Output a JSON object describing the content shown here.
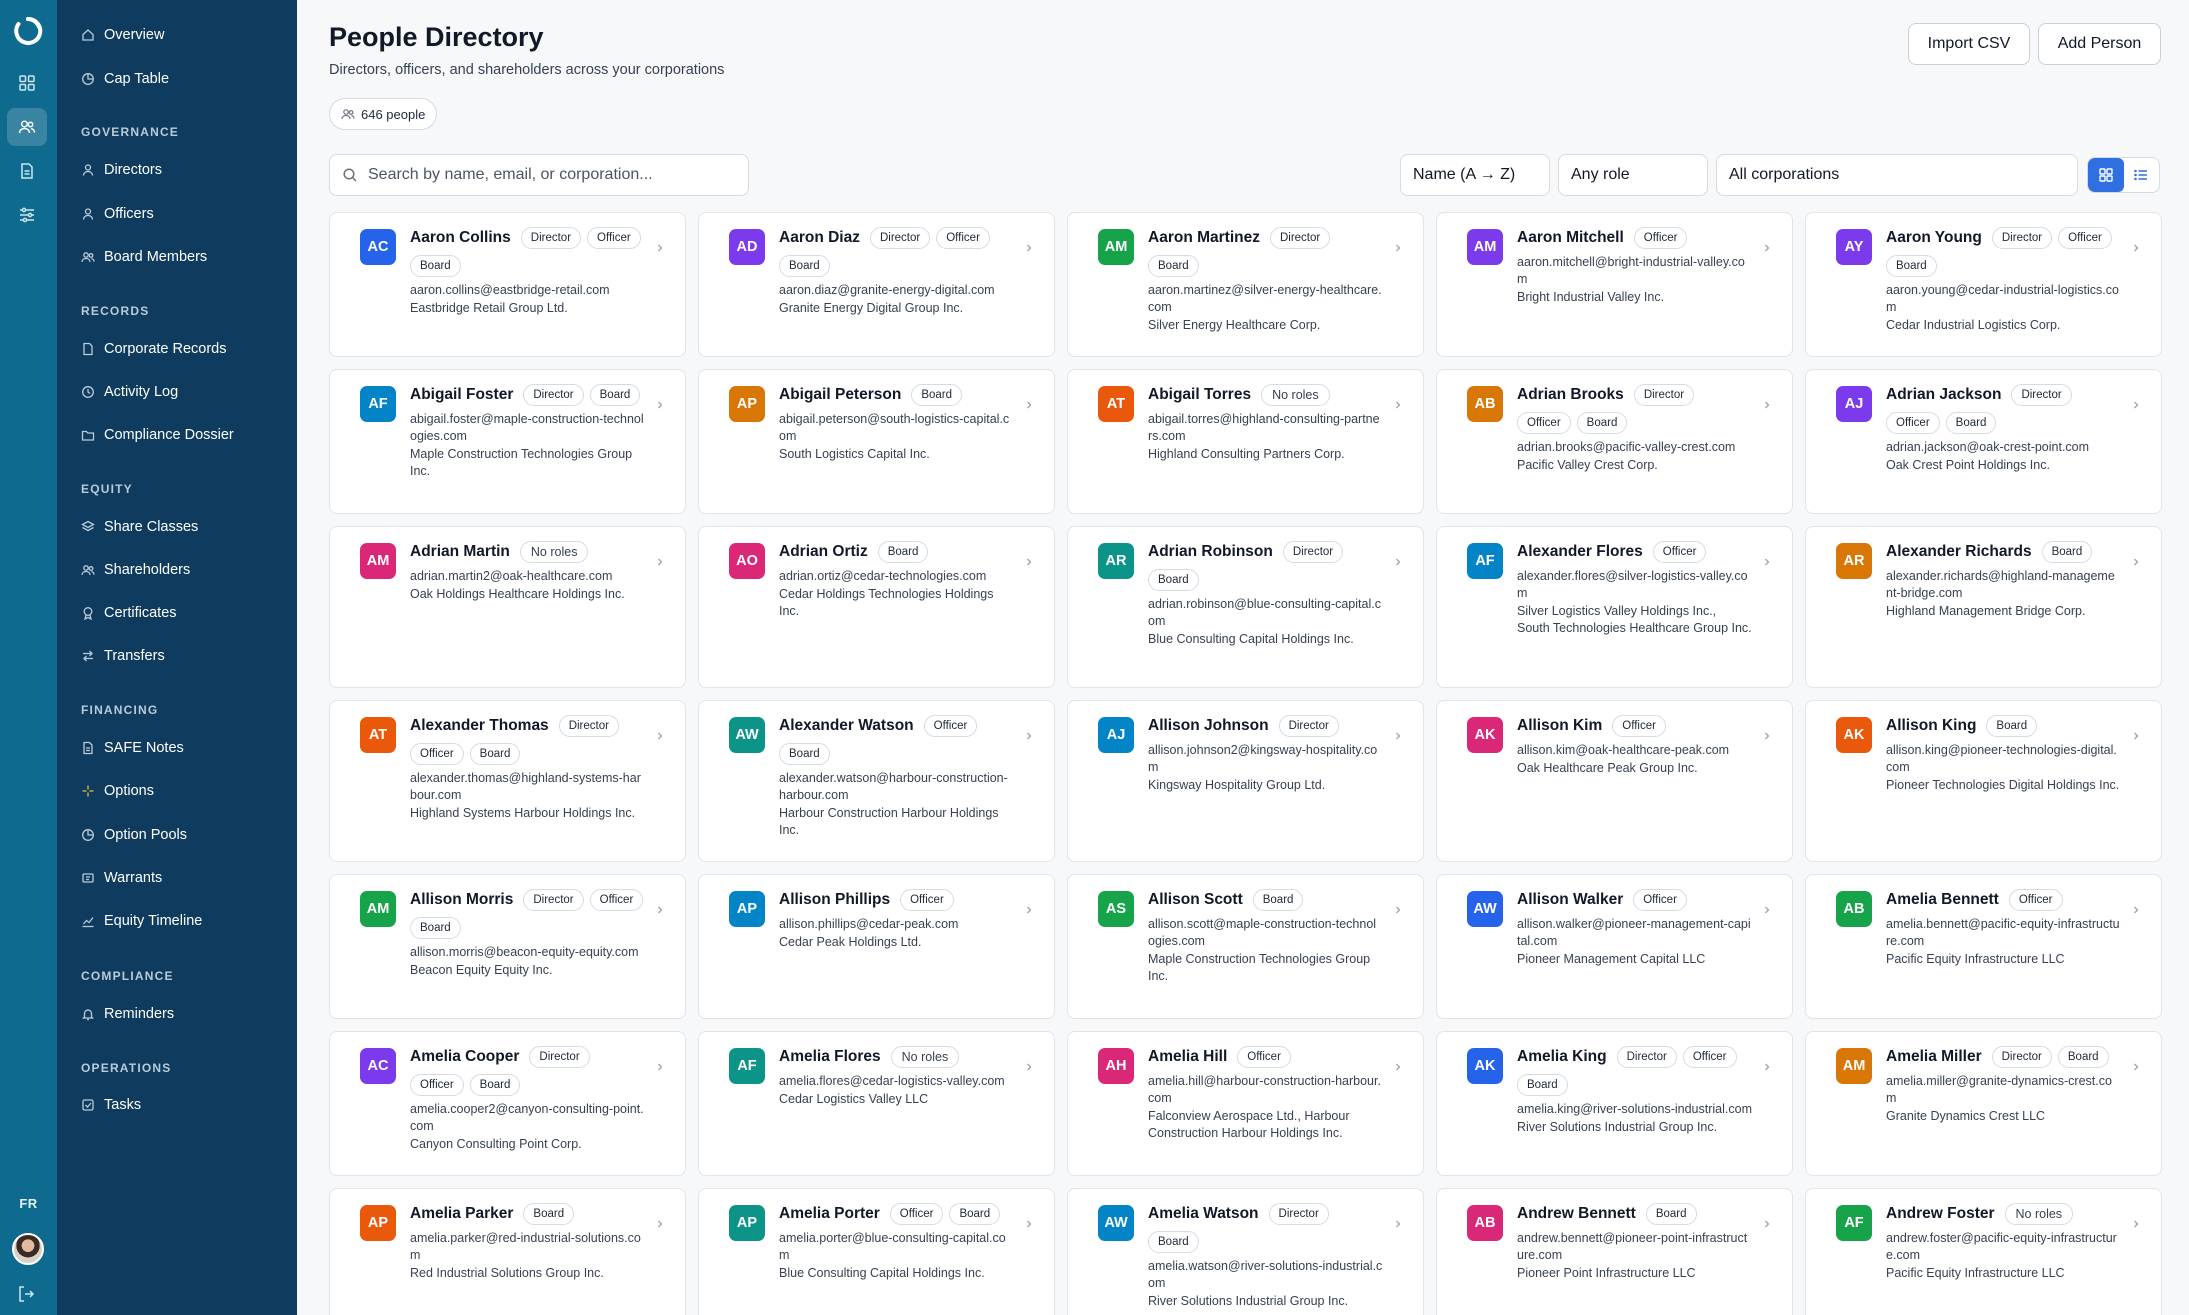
{
  "sidebar": {
    "items": [
      {
        "label": "Overview",
        "icon": "home-icon"
      },
      {
        "label": "Cap Table",
        "icon": "pie-chart-icon"
      }
    ],
    "sections": [
      {
        "title": "GOVERNANCE",
        "items": [
          {
            "label": "Directors",
            "icon": "user-icon"
          },
          {
            "label": "Officers",
            "icon": "user-icon"
          },
          {
            "label": "Board Members",
            "icon": "users-icon"
          }
        ]
      },
      {
        "title": "RECORDS",
        "items": [
          {
            "label": "Corporate Records",
            "icon": "document-icon"
          },
          {
            "label": "Activity Log",
            "icon": "clock-icon"
          },
          {
            "label": "Compliance Dossier",
            "icon": "folder-icon"
          }
        ]
      },
      {
        "title": "EQUITY",
        "items": [
          {
            "label": "Share Classes",
            "icon": "layers-icon"
          },
          {
            "label": "Shareholders",
            "icon": "users-icon"
          },
          {
            "label": "Certificates",
            "icon": "award-icon"
          },
          {
            "label": "Transfers",
            "icon": "transfer-icon"
          }
        ]
      },
      {
        "title": "FINANCING",
        "items": [
          {
            "label": "SAFE Notes",
            "icon": "document-icon"
          },
          {
            "label": "Options",
            "icon": "sparkle-icon"
          },
          {
            "label": "Option Pools",
            "icon": "pie-chart-icon"
          },
          {
            "label": "Warrants",
            "icon": "ticket-icon"
          },
          {
            "label": "Equity Timeline",
            "icon": "chart-icon"
          }
        ]
      },
      {
        "title": "COMPLIANCE",
        "items": [
          {
            "label": "Reminders",
            "icon": "bell-icon"
          }
        ]
      },
      {
        "title": "OPERATIONS",
        "items": [
          {
            "label": "Tasks",
            "icon": "checkbox-icon"
          }
        ]
      }
    ]
  },
  "rail": {
    "language": "FR"
  },
  "header": {
    "title": "People Directory",
    "subtitle": "Directors, officers, and shareholders across your corporations",
    "count_label": "646 people",
    "import_label": "Import CSV",
    "add_label": "Add Person"
  },
  "filters": {
    "search_placeholder": "Search by name, email, or corporation...",
    "sort_value": "Name (A → Z)",
    "role_value": "Any role",
    "corporation_value": "All corporations"
  },
  "colors": {
    "rail": "#0e6a8e",
    "sidebar": "#0f3c5e",
    "accent": "#2f6fe0"
  },
  "people": [
    {
      "initials": "AC",
      "name": "Aaron Collins",
      "roles": [
        "Director",
        "Officer",
        "Board"
      ],
      "email": "aaron.collins@eastbridge-retail.com",
      "corporation": "Eastbridge Retail Group Ltd.",
      "color": "#2563eb"
    },
    {
      "initials": "AD",
      "name": "Aaron Diaz",
      "roles": [
        "Director",
        "Officer",
        "Board"
      ],
      "email": "aaron.diaz@granite-energy-digital.com",
      "corporation": "Granite Energy Digital Group Inc.",
      "color": "#7c3aed"
    },
    {
      "initials": "AM",
      "name": "Aaron Martinez",
      "roles": [
        "Director",
        "Board"
      ],
      "email": "aaron.martinez@silver-energy-healthcare.com",
      "corporation": "Silver Energy Healthcare Corp.",
      "color": "#16a34a"
    },
    {
      "initials": "AM",
      "name": "Aaron Mitchell",
      "roles": [
        "Officer"
      ],
      "email": "aaron.mitchell@bright-industrial-valley.com",
      "corporation": "Bright Industrial Valley Inc.",
      "color": "#7c3aed"
    },
    {
      "initials": "AY",
      "name": "Aaron Young",
      "roles": [
        "Director",
        "Officer",
        "Board"
      ],
      "email": "aaron.young@cedar-industrial-logistics.com",
      "corporation": "Cedar Industrial Logistics Corp.",
      "color": "#7c3aed"
    },
    {
      "initials": "AF",
      "name": "Abigail Foster",
      "roles": [
        "Director",
        "Board"
      ],
      "email": "abigail.foster@maple-construction-technologies.com",
      "corporation": "Maple Construction Technologies Group Inc.",
      "color": "#0284c7"
    },
    {
      "initials": "AP",
      "name": "Abigail Peterson",
      "roles": [
        "Board"
      ],
      "email": "abigail.peterson@south-logistics-capital.com",
      "corporation": "South Logistics Capital Inc.",
      "color": "#d97706"
    },
    {
      "initials": "AT",
      "name": "Abigail Torres",
      "roles": [],
      "email": "abigail.torres@highland-consulting-partners.com",
      "corporation": "Highland Consulting Partners Corp.",
      "color": "#ea580c"
    },
    {
      "initials": "AB",
      "name": "Adrian Brooks",
      "roles": [
        "Director",
        "Officer",
        "Board"
      ],
      "email": "adrian.brooks@pacific-valley-crest.com",
      "corporation": "Pacific Valley Crest Corp.",
      "color": "#d97706"
    },
    {
      "initials": "AJ",
      "name": "Adrian Jackson",
      "roles": [
        "Director",
        "Officer",
        "Board"
      ],
      "email": "adrian.jackson@oak-crest-point.com",
      "corporation": "Oak Crest Point Holdings Inc.",
      "color": "#7c3aed"
    },
    {
      "initials": "AM",
      "name": "Adrian Martin",
      "roles": [],
      "email": "adrian.martin2@oak-healthcare.com",
      "corporation": "Oak Holdings Healthcare Holdings Inc.",
      "color": "#db2777"
    },
    {
      "initials": "AO",
      "name": "Adrian Ortiz",
      "roles": [
        "Board"
      ],
      "email": "adrian.ortiz@cedar-technologies.com",
      "corporation": "Cedar Holdings Technologies Holdings Inc.",
      "color": "#db2777"
    },
    {
      "initials": "AR",
      "name": "Adrian Robinson",
      "roles": [
        "Director",
        "Board"
      ],
      "email": "adrian.robinson@blue-consulting-capital.com",
      "corporation": "Blue Consulting Capital Holdings Inc.",
      "color": "#0d9488"
    },
    {
      "initials": "AF",
      "name": "Alexander Flores",
      "roles": [
        "Officer"
      ],
      "email": "alexander.flores@silver-logistics-valley.com",
      "corporation": "Silver Logistics Valley Holdings Inc., South Technologies Healthcare Group Inc.",
      "color": "#0284c7"
    },
    {
      "initials": "AR",
      "name": "Alexander Richards",
      "roles": [
        "Board"
      ],
      "email": "alexander.richards@highland-management-bridge.com",
      "corporation": "Highland Management Bridge Corp.",
      "color": "#d97706"
    },
    {
      "initials": "AT",
      "name": "Alexander Thomas",
      "roles": [
        "Director",
        "Officer",
        "Board"
      ],
      "email": "alexander.thomas@highland-systems-harbour.com",
      "corporation": "Highland Systems Harbour Holdings Inc.",
      "color": "#ea580c"
    },
    {
      "initials": "AW",
      "name": "Alexander Watson",
      "roles": [
        "Officer",
        "Board"
      ],
      "email": "alexander.watson@harbour-construction-harbour.com",
      "corporation": "Harbour Construction Harbour Holdings Inc.",
      "color": "#0d9488"
    },
    {
      "initials": "AJ",
      "name": "Allison Johnson",
      "roles": [
        "Director"
      ],
      "email": "allison.johnson2@kingsway-hospitality.com",
      "corporation": "Kingsway Hospitality Group Ltd.",
      "color": "#0284c7"
    },
    {
      "initials": "AK",
      "name": "Allison Kim",
      "roles": [
        "Officer"
      ],
      "email": "allison.kim@oak-healthcare-peak.com",
      "corporation": "Oak Healthcare Peak Group Inc.",
      "color": "#db2777"
    },
    {
      "initials": "AK",
      "name": "Allison King",
      "roles": [
        "Board"
      ],
      "email": "allison.king@pioneer-technologies-digital.com",
      "corporation": "Pioneer Technologies Digital Holdings Inc.",
      "color": "#ea580c"
    },
    {
      "initials": "AM",
      "name": "Allison Morris",
      "roles": [
        "Director",
        "Officer",
        "Board"
      ],
      "email": "allison.morris@beacon-equity-equity.com",
      "corporation": "Beacon Equity Equity Inc.",
      "color": "#16a34a"
    },
    {
      "initials": "AP",
      "name": "Allison Phillips",
      "roles": [
        "Officer"
      ],
      "email": "allison.phillips@cedar-peak.com",
      "corporation": "Cedar Peak Holdings Ltd.",
      "color": "#0284c7"
    },
    {
      "initials": "AS",
      "name": "Allison Scott",
      "roles": [
        "Board"
      ],
      "email": "allison.scott@maple-construction-technologies.com",
      "corporation": "Maple Construction Technologies Group Inc.",
      "color": "#16a34a"
    },
    {
      "initials": "AW",
      "name": "Allison Walker",
      "roles": [
        "Officer"
      ],
      "email": "allison.walker@pioneer-management-capital.com",
      "corporation": "Pioneer Management Capital LLC",
      "color": "#2563eb"
    },
    {
      "initials": "AB",
      "name": "Amelia Bennett",
      "roles": [
        "Officer"
      ],
      "email": "amelia.bennett@pacific-equity-infrastructure.com",
      "corporation": "Pacific Equity Infrastructure LLC",
      "color": "#16a34a"
    },
    {
      "initials": "AC",
      "name": "Amelia Cooper",
      "roles": [
        "Director",
        "Officer",
        "Board"
      ],
      "email": "amelia.cooper2@canyon-consulting-point.com",
      "corporation": "Canyon Consulting Point Corp.",
      "color": "#7c3aed"
    },
    {
      "initials": "AF",
      "name": "Amelia Flores",
      "roles": [],
      "email": "amelia.flores@cedar-logistics-valley.com",
      "corporation": "Cedar Logistics Valley LLC",
      "color": "#0d9488"
    },
    {
      "initials": "AH",
      "name": "Amelia Hill",
      "roles": [
        "Officer"
      ],
      "email": "amelia.hill@harbour-construction-harbour.com",
      "corporation": "Falconview Aerospace Ltd., Harbour Construction Harbour Holdings Inc.",
      "color": "#db2777"
    },
    {
      "initials": "AK",
      "name": "Amelia King",
      "roles": [
        "Director",
        "Officer",
        "Board"
      ],
      "email": "amelia.king@river-solutions-industrial.com",
      "corporation": "River Solutions Industrial Group Inc.",
      "color": "#2563eb"
    },
    {
      "initials": "AM",
      "name": "Amelia Miller",
      "roles": [
        "Director",
        "Board"
      ],
      "email": "amelia.miller@granite-dynamics-crest.com",
      "corporation": "Granite Dynamics Crest LLC",
      "color": "#d97706"
    },
    {
      "initials": "AP",
      "name": "Amelia Parker",
      "roles": [
        "Board"
      ],
      "email": "amelia.parker@red-industrial-solutions.com",
      "corporation": "Red Industrial Solutions Group Inc.",
      "color": "#ea580c"
    },
    {
      "initials": "AP",
      "name": "Amelia Porter",
      "roles": [
        "Officer",
        "Board"
      ],
      "email": "amelia.porter@blue-consulting-capital.com",
      "corporation": "Blue Consulting Capital Holdings Inc.",
      "color": "#0d9488"
    },
    {
      "initials": "AW",
      "name": "Amelia Watson",
      "roles": [
        "Director",
        "Board"
      ],
      "email": "amelia.watson@river-solutions-industrial.com",
      "corporation": "River Solutions Industrial Group Inc.",
      "color": "#0284c7"
    },
    {
      "initials": "AB",
      "name": "Andrew Bennett",
      "roles": [
        "Board"
      ],
      "email": "andrew.bennett@pioneer-point-infrastructure.com",
      "corporation": "Pioneer Point Infrastructure LLC",
      "color": "#db2777"
    },
    {
      "initials": "AF",
      "name": "Andrew Foster",
      "roles": [],
      "email": "andrew.foster@pacific-equity-infrastructure.com",
      "corporation": "Pacific Equity Infrastructure LLC",
      "color": "#16a34a"
    }
  ],
  "no_roles_label": "No roles"
}
